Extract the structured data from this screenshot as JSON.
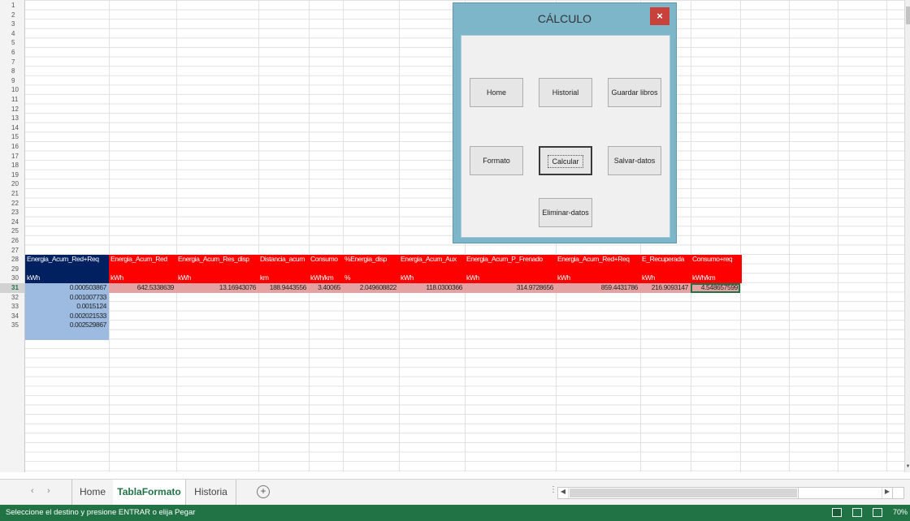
{
  "sheet": {
    "row_numbers": [
      "1",
      "2",
      "3",
      "4",
      "5",
      "6",
      "7",
      "8",
      "9",
      "10",
      "11",
      "12",
      "13",
      "14",
      "15",
      "16",
      "17",
      "18",
      "19",
      "20",
      "21",
      "22",
      "23",
      "24",
      "25",
      "26",
      "27",
      "28",
      "29",
      "30",
      "31",
      "32",
      "33",
      "34",
      "35"
    ],
    "header_row_28": {
      "first": "Energia_Acum_Red+Req",
      "rest": [
        "Energia_Acum_Red",
        "Energia_Acum_Res_disp",
        "Distancia_acum",
        "Consumo",
        "%Energia_disp",
        "Energia_Acum_Aux",
        "Energia_Acum_P_Frenado",
        "Energia_Acum_Red+Req",
        "E_Recuperada",
        "Consumo+req"
      ]
    },
    "units_row_30": {
      "first": "kWh",
      "rest": [
        "kWh",
        "kWh",
        "km",
        "kWh/km",
        "%",
        "kWh",
        "kWh",
        "kWh",
        "kWh",
        "kWh/km"
      ]
    },
    "data_row_31": {
      "first": "0.000503867",
      "rest": [
        "642.5338639",
        "13.16943076",
        "188.9443556",
        "3.40065",
        "2.049608822",
        "118.0300366",
        "314.9728656",
        "859.4431786",
        "216.9093147",
        "4.548657599"
      ]
    },
    "first_col_more": [
      "0.001007733",
      "0.0015124",
      "0.002021533",
      "0.002529867"
    ]
  },
  "dialog": {
    "title": "CÁLCULO",
    "close": "×",
    "buttons": {
      "home": "Home",
      "historial": "Historial",
      "guardar": "Guardar libros",
      "formato": "Formato",
      "calcular": "Calcular",
      "salvar": "Salvar-datos",
      "eliminar": "Eliminar-datos"
    }
  },
  "tabs": {
    "nav_prev": "‹",
    "nav_next": "›",
    "items": [
      "Home",
      "TablaFormato",
      "Historia"
    ],
    "active": "TablaFormato",
    "add": "+",
    "split": "⋮"
  },
  "status": {
    "message": "Seleccione el destino y presione ENTRAR o elija Pegar",
    "zoom": "70%"
  },
  "colors": {
    "header_red": "#ff0000",
    "header_navy": "#002060",
    "pink": "#e6a2a2",
    "light_blue": "#9dbbe0",
    "excel_green": "#217346",
    "dialog_teal": "#7cb6c8"
  },
  "icons": {
    "close": "close-icon",
    "add_sheet": "plus-circle-icon",
    "view_normal": "normal-view-icon",
    "view_layout": "page-layout-icon",
    "view_break": "page-break-icon"
  }
}
